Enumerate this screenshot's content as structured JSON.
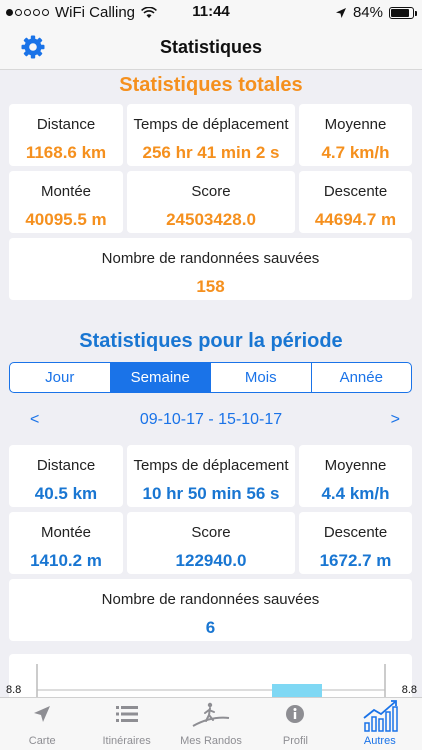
{
  "status": {
    "carrier": "WiFi Calling",
    "time": "11:44",
    "battery": "84%",
    "battery_level": 0.84
  },
  "nav": {
    "title": "Statistiques"
  },
  "totals": {
    "title": "Statistiques totales",
    "distance": {
      "label": "Distance",
      "value": "1168.6 km"
    },
    "moving_time": {
      "label": "Temps de déplacement",
      "value": "256 hr 41 min 2 s"
    },
    "average": {
      "label": "Moyenne",
      "value": "4.7 km/h"
    },
    "ascent": {
      "label": "Montée",
      "value": "40095.5 m"
    },
    "score": {
      "label": "Score",
      "value": "24503428.0"
    },
    "descent": {
      "label": "Descente",
      "value": "44694.7 m"
    },
    "hikes": {
      "label": "Nombre de randonnées sauvées",
      "value": "158"
    }
  },
  "period": {
    "title": "Statistiques pour la période",
    "tabs": [
      "Jour",
      "Semaine",
      "Mois",
      "Année"
    ],
    "prev": "<",
    "range": "09-10-17 - 15-10-17",
    "next": ">",
    "distance": {
      "label": "Distance",
      "value": "40.5 km"
    },
    "moving_time": {
      "label": "Temps de déplacement",
      "value": "10 hr 50 min 56 s"
    },
    "average": {
      "label": "Moyenne",
      "value": "4.4 km/h"
    },
    "ascent": {
      "label": "Montée",
      "value": "1410.2 m"
    },
    "score": {
      "label": "Score",
      "value": "122940.0"
    },
    "descent": {
      "label": "Descente",
      "value": "1672.7 m"
    },
    "hikes": {
      "label": "Nombre de randonnées sauvées",
      "value": "6"
    }
  },
  "chart": {
    "y_max_label_left": "8.8",
    "y_max_label_right": "8.8"
  },
  "tabbar": {
    "carte": "Carte",
    "itineraires": "Itinéraires",
    "mes_randos": "Mes Randos",
    "profil": "Profil",
    "autres": "Autres"
  },
  "colors": {
    "accent_blue": "#1a73e8",
    "accent_orange": "#f5901e",
    "chart_bar": "#7fd8f4"
  }
}
